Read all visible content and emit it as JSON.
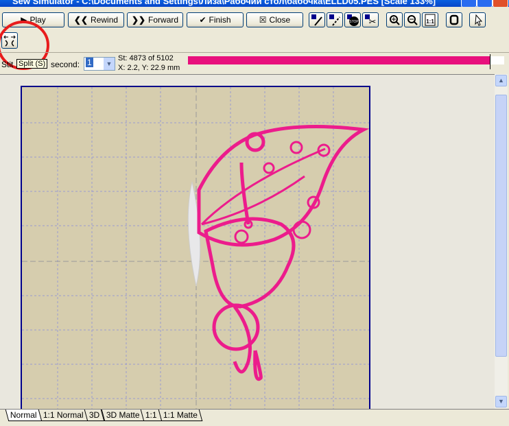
{
  "window": {
    "title": "Sew Simulator - C:\\Documents and Settings\\Лиза\\Рабочий стол\\бабочка\\ELLD05.PES [Scale 133%]"
  },
  "toolbar": {
    "play": "Play",
    "rewind": "Rewind",
    "forward": "Forward",
    "finish": "Finish",
    "close": "Close",
    "icons": [
      "jump-stitch-icon",
      "trim-stitch-icon",
      "stop-icon",
      "scissors-icon",
      "zoom-in-icon",
      "zoom-out-icon",
      "actual-size-icon",
      "fit-icon",
      "pointer-icon",
      "split-icon"
    ]
  },
  "status": {
    "label_prefix": "Stit",
    "tooltip": "Split (S)",
    "label_suffix": "second:",
    "speed_value": "1",
    "stitch": "St: 4873 of 5102",
    "coords": "X: 2.2, Y: 22.9 mm",
    "progress_percent": 95.5,
    "progress_color": "#e8107c"
  },
  "tabs": [
    "Normal",
    "1:1 Normal",
    "3D",
    "3D Matte",
    "1:1",
    "1:1 Matte"
  ],
  "active_tab": "Normal",
  "colors": {
    "thread": "#ec1c8c",
    "design_bg": "#d6cdae",
    "annotation": "#e81c1c"
  }
}
